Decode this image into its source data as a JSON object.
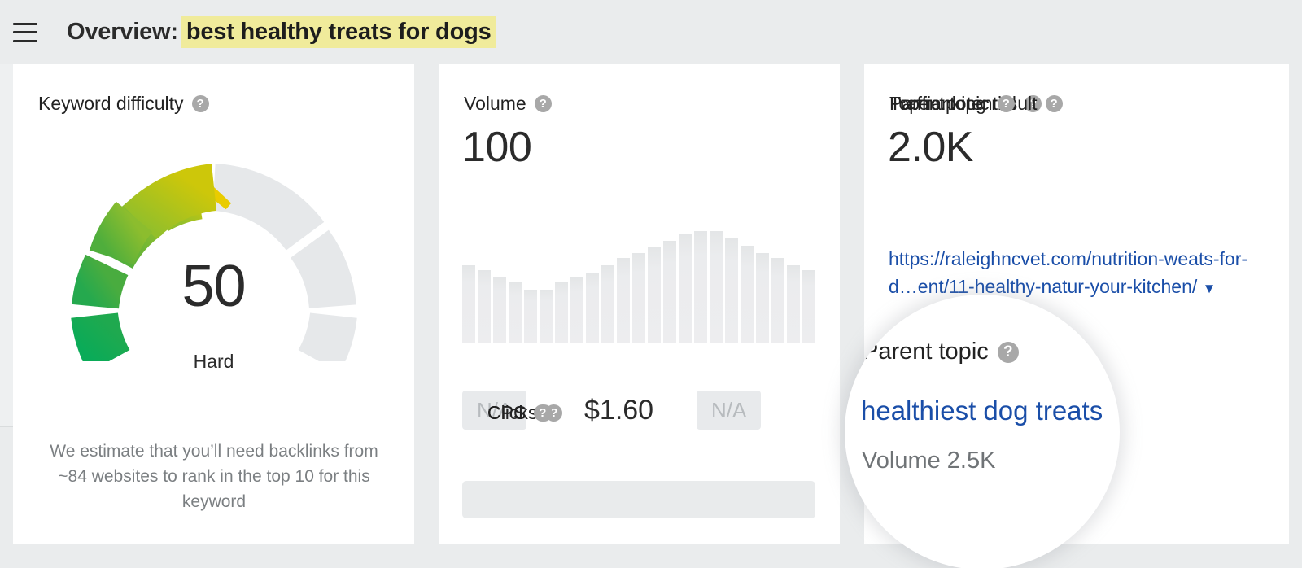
{
  "header": {
    "menu_icon": "hamburger-menu-icon",
    "title_prefix": "Overview:",
    "keyword": "best healthy treats for dogs",
    "highlight_color": "#f0eb9b"
  },
  "help_glyph": "?",
  "cards": {
    "keyword_difficulty": {
      "label": "Keyword difficulty",
      "value": "50",
      "rating": "Hard",
      "note": "We estimate that you’ll need backlinks from ~84 websites to rank in the top 10 for this keyword",
      "gauge": {
        "filled_percent": 50,
        "segments": 10,
        "colors": [
          "#0eab5b",
          "#22a94f",
          "#3da944",
          "#5cb03a",
          "#86bb32",
          "#b5c41a",
          "#d6c900",
          "#e8cc00"
        ],
        "track_color": "#e6e8ea"
      }
    },
    "volume": {
      "label": "Volume",
      "value": "100",
      "metrics": [
        {
          "label": "Clicks",
          "value": "N/A",
          "is_na": true
        },
        {
          "label": "CPC",
          "value": "$1.60",
          "is_na": false
        },
        {
          "label": "CPS",
          "value": "N/A",
          "is_na": true
        }
      ]
    },
    "traffic_potential": {
      "label": "Traffic potential",
      "value": "2.0K",
      "top_ranking_label": "Top ranking result",
      "top_ranking_url_line1": "https://raleighncvet.com/nutrition-w",
      "top_ranking_url_line2": "eats-for-d…ent/11-healthy-natur",
      "top_ranking_url_line3": "-your-kitchen/",
      "caret": "▼",
      "parent_topic_label": "Parent topic",
      "parent_topic_keyword": "healthiest dog treats",
      "parent_topic_volume": "Volume 2.5K"
    }
  },
  "magnifier": {
    "label": "Parent topic",
    "keyword": "healthiest dog treats",
    "volume": "Volume 2.5K"
  },
  "chart_data": {
    "type": "bar",
    "title": "Volume",
    "xlabel": "",
    "ylabel": "",
    "grid": false,
    "legend": null,
    "categories": [
      "1",
      "2",
      "3",
      "4",
      "5",
      "6",
      "7",
      "8",
      "9",
      "10",
      "11",
      "12",
      "13",
      "14",
      "15",
      "16",
      "17",
      "18",
      "19",
      "20",
      "21",
      "22",
      "23"
    ],
    "values": [
      64,
      60,
      55,
      50,
      44,
      44,
      50,
      54,
      58,
      64,
      70,
      74,
      79,
      84,
      90,
      92,
      92,
      86,
      80,
      74,
      70,
      64,
      60
    ],
    "ylim": [
      0,
      100
    ],
    "bar_color": "#ededef"
  }
}
